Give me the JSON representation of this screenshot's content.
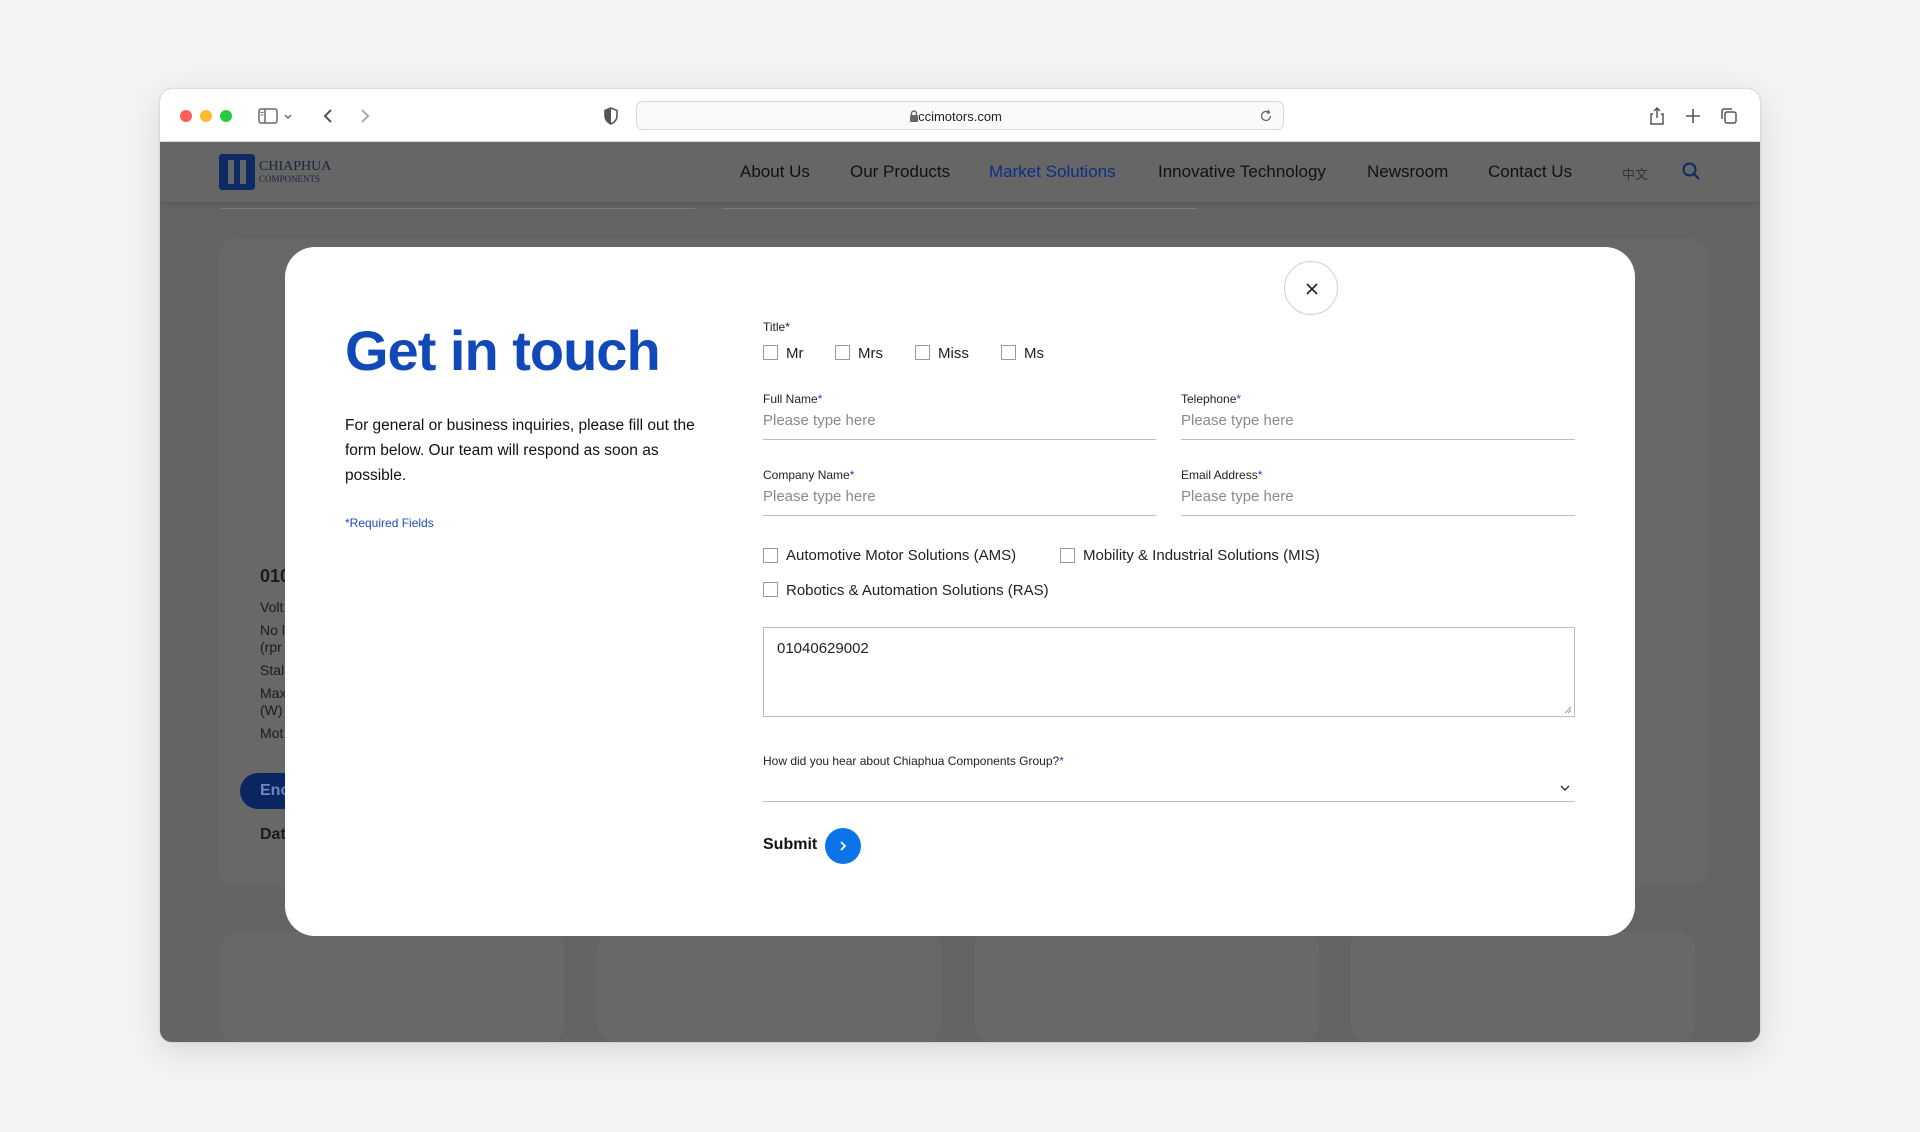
{
  "browser": {
    "url": "ccimotors.com"
  },
  "site": {
    "logo": {
      "line1": "CHIAPHUA",
      "line2": "COMPONENTS"
    },
    "nav": [
      {
        "label": "About Us"
      },
      {
        "label": "Our Products"
      },
      {
        "label": "Market Solutions",
        "active": true
      },
      {
        "label": "Innovative Technology"
      },
      {
        "label": "Newsroom"
      },
      {
        "label": "Contact Us"
      }
    ],
    "lang": "中文",
    "background_fragments": [
      "010",
      "Volt",
      "No l",
      "(rpr",
      "Stal",
      "Max",
      "(W)",
      "Mot",
      "Enc",
      "Dat"
    ]
  },
  "modal": {
    "title": "Get in touch",
    "intro": "For general or business inquiries, please fill out the form below. Our team will respond as soon as possible.",
    "required_note": "*Required Fields",
    "title_field": {
      "label": "Title",
      "required_mark": "*",
      "options": [
        "Mr",
        "Mrs",
        "Miss",
        "Ms"
      ]
    },
    "full_name": {
      "label": "Full Name",
      "required_mark": "*",
      "placeholder": "Please type here"
    },
    "telephone": {
      "label": "Telephone",
      "required_mark": "*",
      "placeholder": "Please type here"
    },
    "company": {
      "label": "Company Name",
      "required_mark": "*",
      "placeholder": "Please type here"
    },
    "email": {
      "label": "Email Address",
      "required_mark": "*",
      "placeholder": "Please type here"
    },
    "solutions": [
      "Automotive Motor Solutions (AMS)",
      "Mobility & Industrial Solutions (MIS)",
      "Robotics & Automation Solutions (RAS)"
    ],
    "message_value": "01040629002",
    "source": {
      "label": "How did you hear about Chiaphua Components Group?",
      "required_mark": "*"
    },
    "submit": "Submit"
  },
  "colors": {
    "accent": "#1149b8",
    "submit_button": "#0b74e8",
    "overlay": "#646464"
  }
}
